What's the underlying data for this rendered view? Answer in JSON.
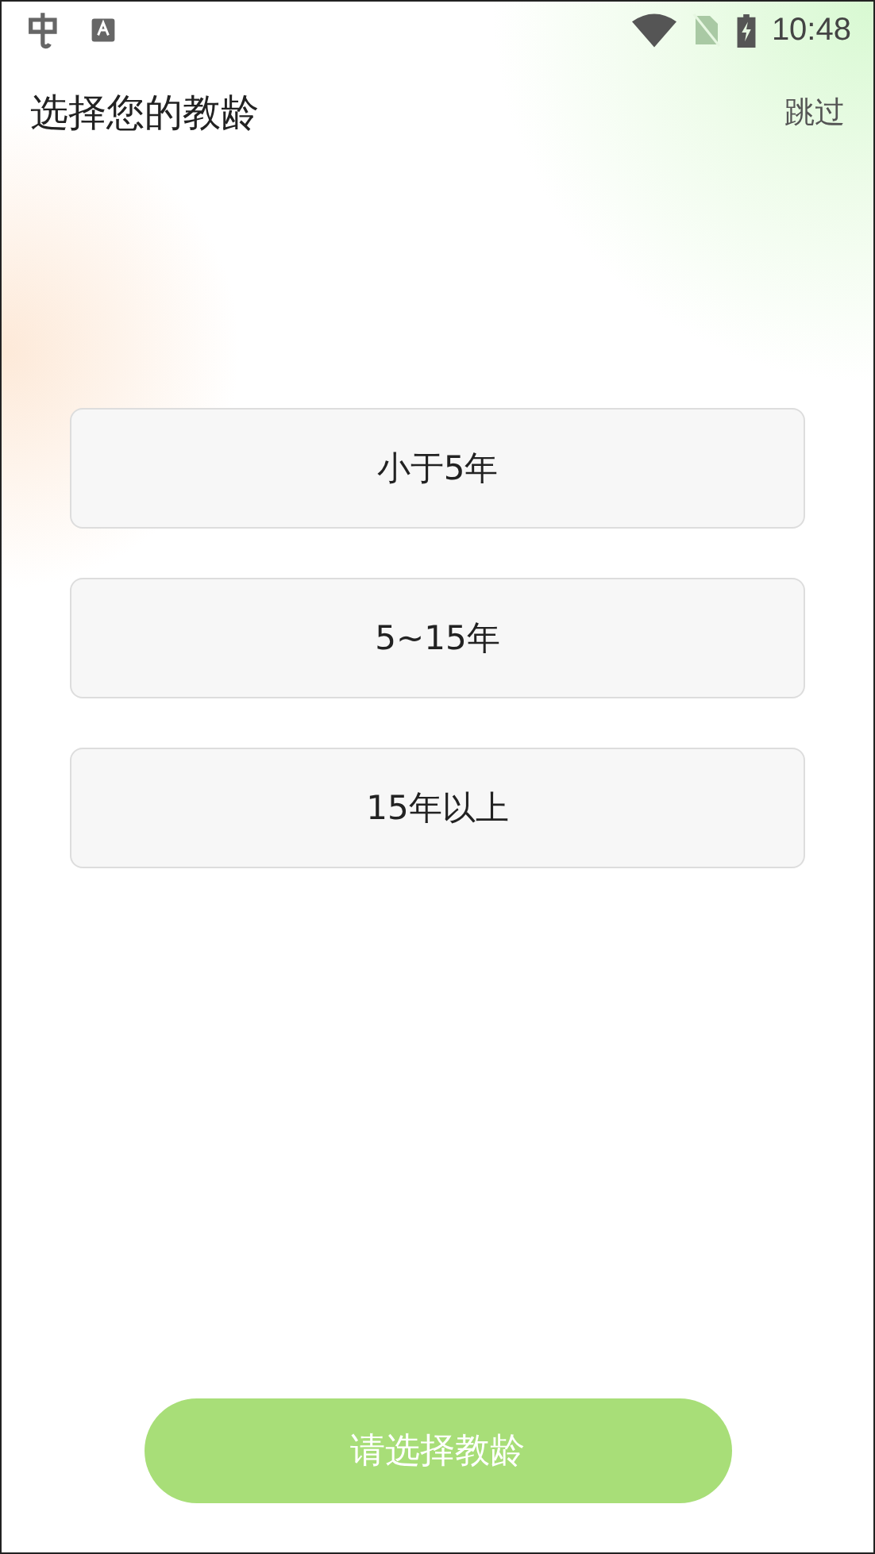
{
  "status_bar": {
    "time": "10:48"
  },
  "header": {
    "title": "选择您的教龄",
    "skip": "跳过"
  },
  "options": [
    {
      "label": "小于5年",
      "selected": false
    },
    {
      "label": "5~15年",
      "selected": false
    },
    {
      "label": "15年以上",
      "selected": false
    }
  ],
  "confirm_button": {
    "label": "请选择教龄",
    "disabled": true
  }
}
